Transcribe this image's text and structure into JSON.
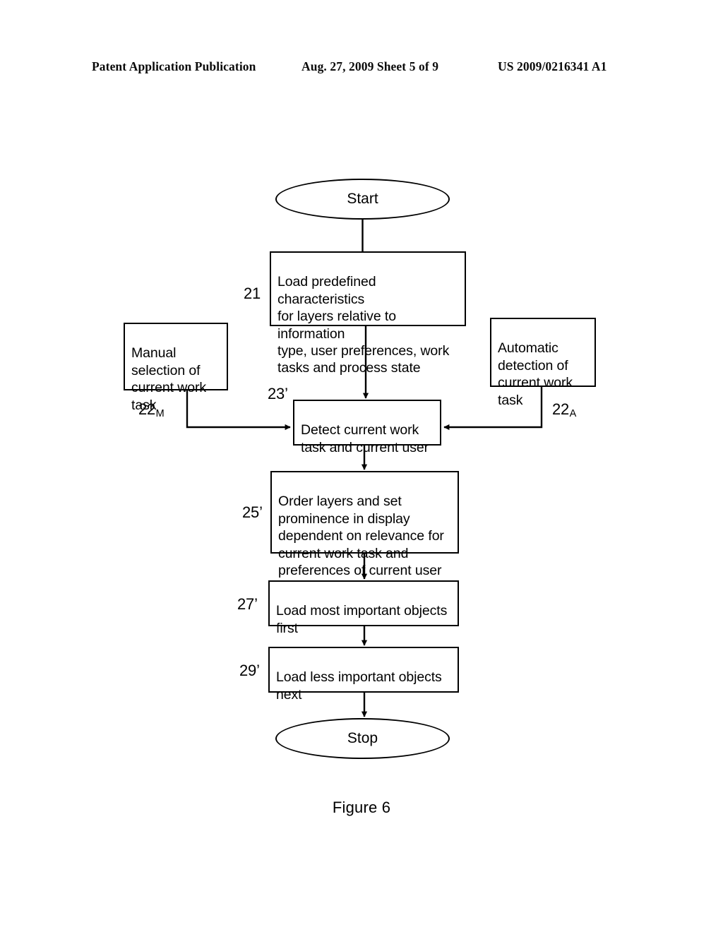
{
  "header": {
    "publication": "Patent Application Publication",
    "date_sheet": "Aug. 27, 2009  Sheet 5 of 9",
    "document_id": "US 2009/0216341 A1"
  },
  "figure": {
    "caption": "Figure 6"
  },
  "nodes": {
    "start": {
      "label": "Start",
      "ref": ""
    },
    "step21": {
      "label": "Load predefined characteristics\nfor layers relative to information\ntype, user preferences, work\ntasks and  process state",
      "ref": "21"
    },
    "manual": {
      "label": "Manual\nselection of\ncurrent work\ntask",
      "ref": "22",
      "ref_sub": "M"
    },
    "automatic": {
      "label": "Automatic\ndetection of\ncurrent work\ntask",
      "ref": "22",
      "ref_sub": "A"
    },
    "step23": {
      "label": "Detect current work\ntask and current user",
      "ref": "23’"
    },
    "step25": {
      "label": "Order layers and set\nprominence in display\ndependent on relevance for\ncurrent work task and\npreferences of current user",
      "ref": "25’"
    },
    "step27": {
      "label": "Load most important objects\nfirst",
      "ref": "27’"
    },
    "step29": {
      "label": "Load less important objects\nnext",
      "ref": "29’"
    },
    "stop": {
      "label": "Stop",
      "ref": ""
    }
  },
  "colors": {
    "ink": "#000000",
    "paper": "#ffffff"
  }
}
